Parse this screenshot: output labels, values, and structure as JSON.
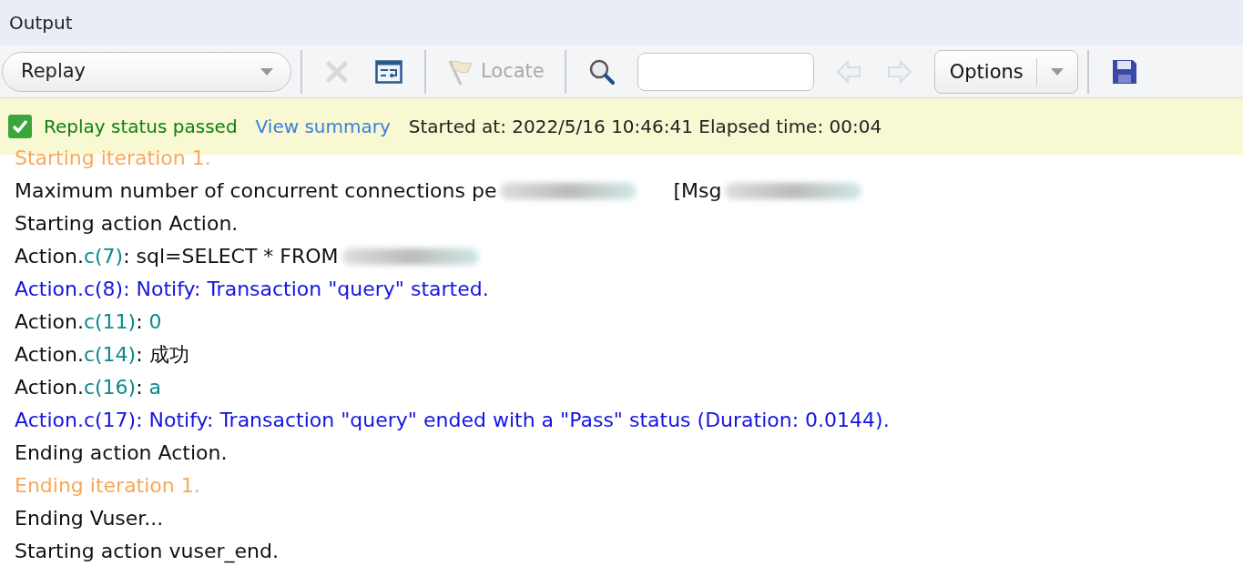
{
  "panel": {
    "title": "Output"
  },
  "toolbar": [
    {
      "kind": "dropdown",
      "label": "Replay"
    },
    {
      "kind": "clear",
      "disabled": true
    },
    {
      "kind": "wrap",
      "disabled": false
    },
    {
      "kind": "locate",
      "label": "Locate",
      "disabled": true
    },
    {
      "kind": "search"
    },
    {
      "kind": "prev",
      "disabled": true
    },
    {
      "kind": "next",
      "disabled": true
    },
    {
      "kind": "options",
      "label": "Options"
    },
    {
      "kind": "save",
      "disabled": false
    }
  ],
  "status": {
    "passed": true,
    "message": "Replay status passed",
    "link": "View summary",
    "info": "Started at: 2022/5/16 10:46:41 Elapsed time: 00:04"
  },
  "log": [
    {
      "kind": "iteration",
      "parts": [
        {
          "kind": "text",
          "text": "Starting iteration 1."
        }
      ]
    },
    {
      "kind": "info",
      "parts": [
        {
          "kind": "text",
          "text": "Maximum number of concurrent connections pe"
        }
      ],
      "redacted": true,
      "tail": "[Msg"
    },
    {
      "kind": "info",
      "parts": [
        {
          "kind": "text",
          "text": "Starting action Action."
        }
      ]
    },
    {
      "kind": "info",
      "parts": [
        {
          "kind": "text",
          "text": "Action."
        },
        {
          "kind": "ref",
          "text": "c(7)"
        },
        {
          "kind": "text",
          "text": ": sql=SELECT * FROM"
        }
      ],
      "redacted": true
    },
    {
      "kind": "notify",
      "parts": [
        {
          "kind": "text",
          "text": "Action.c(8): Notify: Transaction \"query\" started."
        }
      ]
    },
    {
      "kind": "info",
      "parts": [
        {
          "kind": "text",
          "text": "Action."
        },
        {
          "kind": "ref",
          "text": "c(11)"
        },
        {
          "kind": "text",
          "text": ": "
        },
        {
          "kind": "ref",
          "text": "0"
        }
      ]
    },
    {
      "kind": "info",
      "parts": [
        {
          "kind": "text",
          "text": "Action."
        },
        {
          "kind": "ref",
          "text": "c(14)"
        },
        {
          "kind": "text",
          "text": ": 成功"
        }
      ]
    },
    {
      "kind": "info",
      "parts": [
        {
          "kind": "text",
          "text": "Action."
        },
        {
          "kind": "ref",
          "text": "c(16)"
        },
        {
          "kind": "text",
          "text": ": "
        },
        {
          "kind": "ref",
          "text": "a"
        }
      ]
    },
    {
      "kind": "notify",
      "parts": [
        {
          "kind": "text",
          "text": "Action.c(17): Notify: Transaction \"query\" ended with a \"Pass\" status (Duration: 0.0144)."
        }
      ]
    },
    {
      "kind": "info",
      "parts": [
        {
          "kind": "text",
          "text": "Ending action Action."
        }
      ]
    },
    {
      "kind": "iteration",
      "parts": [
        {
          "kind": "text",
          "text": "Ending iteration 1."
        }
      ]
    },
    {
      "kind": "info",
      "parts": [
        {
          "kind": "text",
          "text": "Ending Vuser..."
        }
      ]
    },
    {
      "kind": "info",
      "parts": [
        {
          "kind": "text",
          "text": "Starting action vuser_end."
        }
      ]
    }
  ]
}
